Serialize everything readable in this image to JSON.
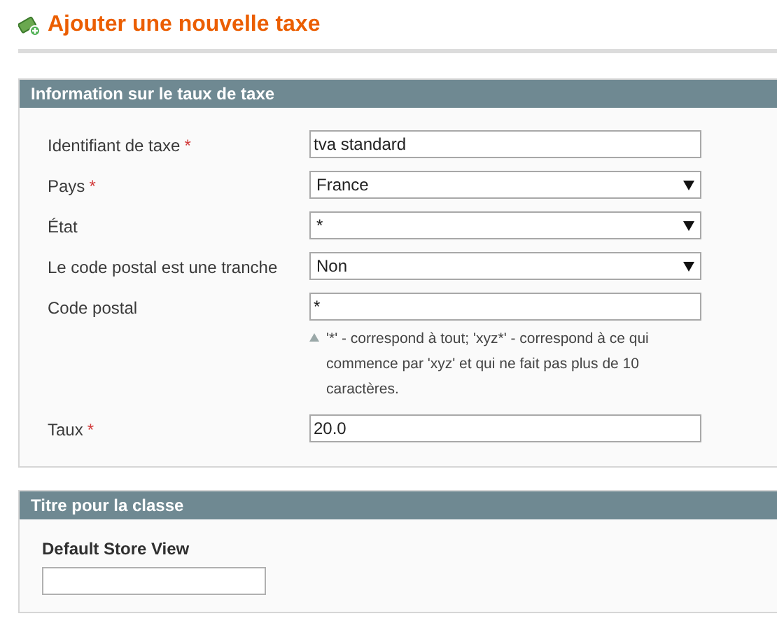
{
  "page_title": "Ajouter une nouvelle taxe",
  "sections": [
    {
      "title": "Information sur le taux de taxe",
      "fields": [
        {
          "kind": "text",
          "label": "Identifiant de taxe",
          "required_mark": "*",
          "value": "tva standard"
        },
        {
          "kind": "select",
          "label": "Pays",
          "required_mark": "*",
          "value": "France"
        },
        {
          "kind": "select",
          "label": "État",
          "value": "*"
        },
        {
          "kind": "select",
          "label": "Le code postal est une tranche",
          "value": "Non"
        },
        {
          "kind": "text",
          "label": "Code postal",
          "value": "*",
          "hint": "'*' - correspond à tout; 'xyz*' - correspond à ce qui commence par 'xyz' et qui ne fait pas plus de 10 caractères."
        },
        {
          "kind": "text",
          "label": "Taux",
          "required_mark": "*",
          "value": "20.0"
        }
      ]
    },
    {
      "title": "Titre pour la classe",
      "fields": [
        {
          "kind": "stacked",
          "label": "Default Store View"
        }
      ]
    }
  ]
}
